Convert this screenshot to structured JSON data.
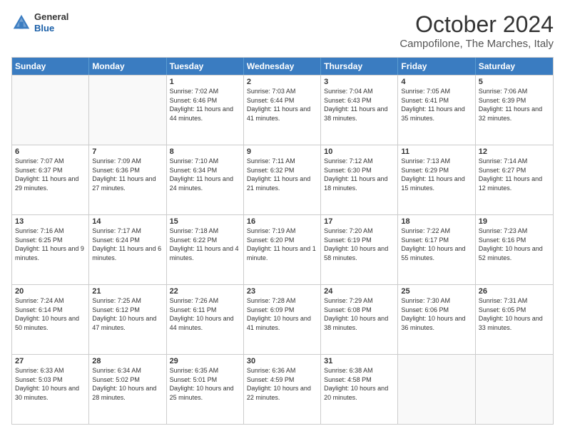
{
  "header": {
    "logo_general": "General",
    "logo_blue": "Blue",
    "month_title": "October 2024",
    "location": "Campofilone, The Marches, Italy"
  },
  "weekdays": [
    "Sunday",
    "Monday",
    "Tuesday",
    "Wednesday",
    "Thursday",
    "Friday",
    "Saturday"
  ],
  "weeks": [
    [
      {
        "day": "",
        "sunrise": "",
        "sunset": "",
        "daylight": ""
      },
      {
        "day": "",
        "sunrise": "",
        "sunset": "",
        "daylight": ""
      },
      {
        "day": "1",
        "sunrise": "Sunrise: 7:02 AM",
        "sunset": "Sunset: 6:46 PM",
        "daylight": "Daylight: 11 hours and 44 minutes."
      },
      {
        "day": "2",
        "sunrise": "Sunrise: 7:03 AM",
        "sunset": "Sunset: 6:44 PM",
        "daylight": "Daylight: 11 hours and 41 minutes."
      },
      {
        "day": "3",
        "sunrise": "Sunrise: 7:04 AM",
        "sunset": "Sunset: 6:43 PM",
        "daylight": "Daylight: 11 hours and 38 minutes."
      },
      {
        "day": "4",
        "sunrise": "Sunrise: 7:05 AM",
        "sunset": "Sunset: 6:41 PM",
        "daylight": "Daylight: 11 hours and 35 minutes."
      },
      {
        "day": "5",
        "sunrise": "Sunrise: 7:06 AM",
        "sunset": "Sunset: 6:39 PM",
        "daylight": "Daylight: 11 hours and 32 minutes."
      }
    ],
    [
      {
        "day": "6",
        "sunrise": "Sunrise: 7:07 AM",
        "sunset": "Sunset: 6:37 PM",
        "daylight": "Daylight: 11 hours and 29 minutes."
      },
      {
        "day": "7",
        "sunrise": "Sunrise: 7:09 AM",
        "sunset": "Sunset: 6:36 PM",
        "daylight": "Daylight: 11 hours and 27 minutes."
      },
      {
        "day": "8",
        "sunrise": "Sunrise: 7:10 AM",
        "sunset": "Sunset: 6:34 PM",
        "daylight": "Daylight: 11 hours and 24 minutes."
      },
      {
        "day": "9",
        "sunrise": "Sunrise: 7:11 AM",
        "sunset": "Sunset: 6:32 PM",
        "daylight": "Daylight: 11 hours and 21 minutes."
      },
      {
        "day": "10",
        "sunrise": "Sunrise: 7:12 AM",
        "sunset": "Sunset: 6:30 PM",
        "daylight": "Daylight: 11 hours and 18 minutes."
      },
      {
        "day": "11",
        "sunrise": "Sunrise: 7:13 AM",
        "sunset": "Sunset: 6:29 PM",
        "daylight": "Daylight: 11 hours and 15 minutes."
      },
      {
        "day": "12",
        "sunrise": "Sunrise: 7:14 AM",
        "sunset": "Sunset: 6:27 PM",
        "daylight": "Daylight: 11 hours and 12 minutes."
      }
    ],
    [
      {
        "day": "13",
        "sunrise": "Sunrise: 7:16 AM",
        "sunset": "Sunset: 6:25 PM",
        "daylight": "Daylight: 11 hours and 9 minutes."
      },
      {
        "day": "14",
        "sunrise": "Sunrise: 7:17 AM",
        "sunset": "Sunset: 6:24 PM",
        "daylight": "Daylight: 11 hours and 6 minutes."
      },
      {
        "day": "15",
        "sunrise": "Sunrise: 7:18 AM",
        "sunset": "Sunset: 6:22 PM",
        "daylight": "Daylight: 11 hours and 4 minutes."
      },
      {
        "day": "16",
        "sunrise": "Sunrise: 7:19 AM",
        "sunset": "Sunset: 6:20 PM",
        "daylight": "Daylight: 11 hours and 1 minute."
      },
      {
        "day": "17",
        "sunrise": "Sunrise: 7:20 AM",
        "sunset": "Sunset: 6:19 PM",
        "daylight": "Daylight: 10 hours and 58 minutes."
      },
      {
        "day": "18",
        "sunrise": "Sunrise: 7:22 AM",
        "sunset": "Sunset: 6:17 PM",
        "daylight": "Daylight: 10 hours and 55 minutes."
      },
      {
        "day": "19",
        "sunrise": "Sunrise: 7:23 AM",
        "sunset": "Sunset: 6:16 PM",
        "daylight": "Daylight: 10 hours and 52 minutes."
      }
    ],
    [
      {
        "day": "20",
        "sunrise": "Sunrise: 7:24 AM",
        "sunset": "Sunset: 6:14 PM",
        "daylight": "Daylight: 10 hours and 50 minutes."
      },
      {
        "day": "21",
        "sunrise": "Sunrise: 7:25 AM",
        "sunset": "Sunset: 6:12 PM",
        "daylight": "Daylight: 10 hours and 47 minutes."
      },
      {
        "day": "22",
        "sunrise": "Sunrise: 7:26 AM",
        "sunset": "Sunset: 6:11 PM",
        "daylight": "Daylight: 10 hours and 44 minutes."
      },
      {
        "day": "23",
        "sunrise": "Sunrise: 7:28 AM",
        "sunset": "Sunset: 6:09 PM",
        "daylight": "Daylight: 10 hours and 41 minutes."
      },
      {
        "day": "24",
        "sunrise": "Sunrise: 7:29 AM",
        "sunset": "Sunset: 6:08 PM",
        "daylight": "Daylight: 10 hours and 38 minutes."
      },
      {
        "day": "25",
        "sunrise": "Sunrise: 7:30 AM",
        "sunset": "Sunset: 6:06 PM",
        "daylight": "Daylight: 10 hours and 36 minutes."
      },
      {
        "day": "26",
        "sunrise": "Sunrise: 7:31 AM",
        "sunset": "Sunset: 6:05 PM",
        "daylight": "Daylight: 10 hours and 33 minutes."
      }
    ],
    [
      {
        "day": "27",
        "sunrise": "Sunrise: 6:33 AM",
        "sunset": "Sunset: 5:03 PM",
        "daylight": "Daylight: 10 hours and 30 minutes."
      },
      {
        "day": "28",
        "sunrise": "Sunrise: 6:34 AM",
        "sunset": "Sunset: 5:02 PM",
        "daylight": "Daylight: 10 hours and 28 minutes."
      },
      {
        "day": "29",
        "sunrise": "Sunrise: 6:35 AM",
        "sunset": "Sunset: 5:01 PM",
        "daylight": "Daylight: 10 hours and 25 minutes."
      },
      {
        "day": "30",
        "sunrise": "Sunrise: 6:36 AM",
        "sunset": "Sunset: 4:59 PM",
        "daylight": "Daylight: 10 hours and 22 minutes."
      },
      {
        "day": "31",
        "sunrise": "Sunrise: 6:38 AM",
        "sunset": "Sunset: 4:58 PM",
        "daylight": "Daylight: 10 hours and 20 minutes."
      },
      {
        "day": "",
        "sunrise": "",
        "sunset": "",
        "daylight": ""
      },
      {
        "day": "",
        "sunrise": "",
        "sunset": "",
        "daylight": ""
      }
    ]
  ]
}
